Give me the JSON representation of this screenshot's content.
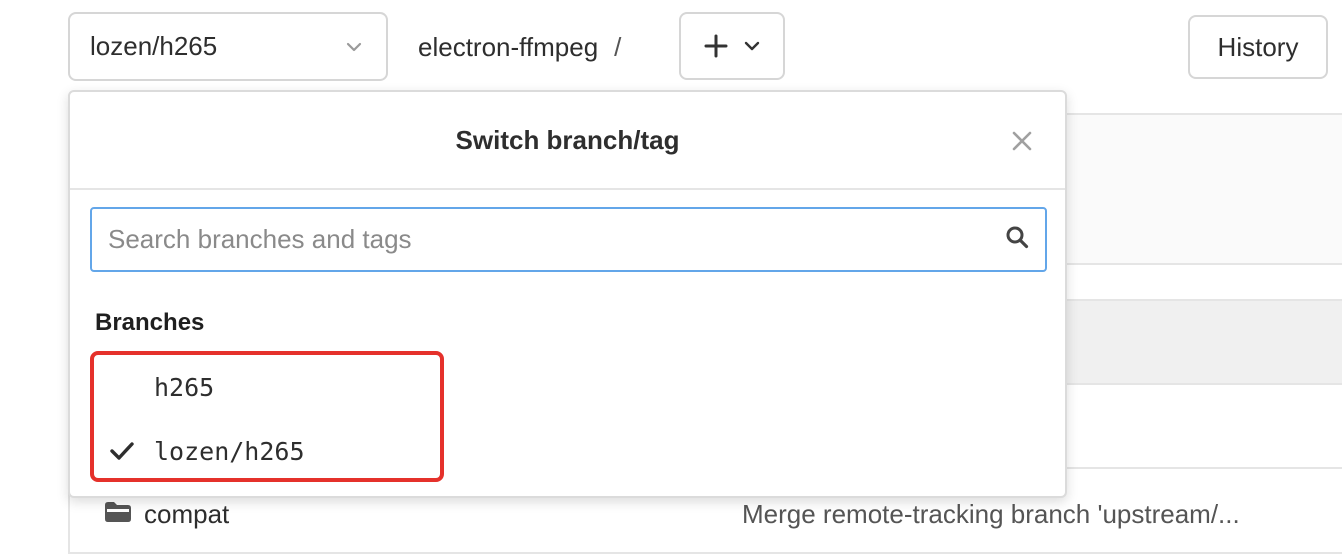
{
  "toolbar": {
    "branch_select_label": "lozen/h265",
    "repo_name": "electron-ffmpeg",
    "path_separator": "/",
    "history_label": "History"
  },
  "dropdown": {
    "title": "Switch branch/tag",
    "search_placeholder": "Search branches and tags",
    "search_value": "",
    "section_branches": "Branches",
    "branches": [
      {
        "name": "h265",
        "selected": false
      },
      {
        "name": "lozen/h265",
        "selected": true
      }
    ]
  },
  "files": [
    {
      "name": "compat",
      "type": "folder",
      "commit_message": "Merge remote-tracking branch 'upstream/..."
    }
  ],
  "colors": {
    "highlight": "#e5312b",
    "focus_border": "#63a6e9",
    "border": "#d6d6d6"
  },
  "icons": {
    "branch_select": "chevron-down-icon",
    "add": "plus-icon",
    "add_menu": "chevron-down-icon",
    "close": "close-icon",
    "search": "search-icon",
    "selected": "check-icon",
    "folder": "folder-icon"
  }
}
